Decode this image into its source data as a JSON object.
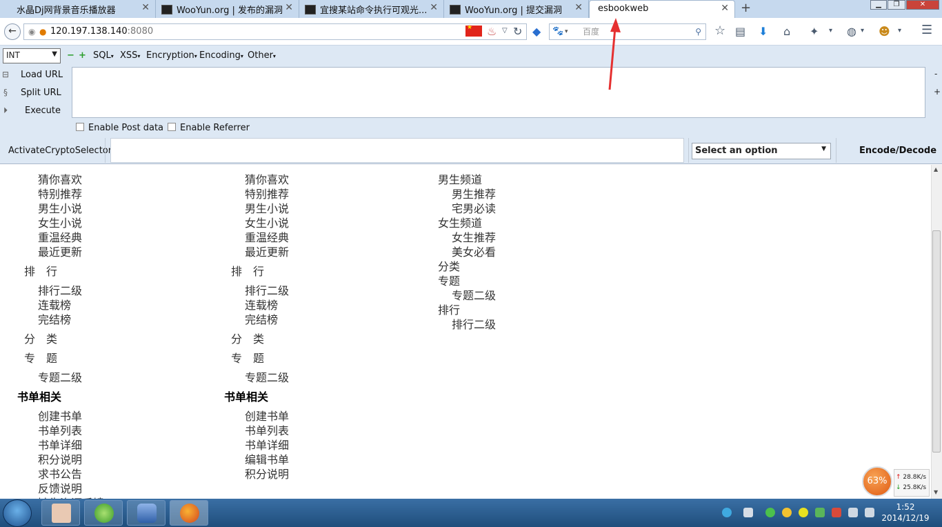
{
  "tabs": [
    {
      "title": "水晶Dj网背景音乐播放器",
      "active": false
    },
    {
      "title": "WooYun.org | 发布的漏洞",
      "active": false
    },
    {
      "title": "宜搜某站命令执行可观光...",
      "active": false
    },
    {
      "title": "WooYun.org | 提交漏洞",
      "active": false
    },
    {
      "title": "esbookweb",
      "active": true
    }
  ],
  "nav": {
    "url_host": "120.197.138.140",
    "url_port": ":8080",
    "search_placeholder": "百度"
  },
  "hackbar": {
    "type_select": "INT",
    "menus": [
      "SQL",
      "XSS",
      "Encryption",
      "Encoding",
      "Other"
    ],
    "load_url": "Load URL",
    "split_url": "Split URL",
    "execute": "Execute",
    "enable_post": "Enable Post data",
    "enable_referrer": "Enable Referrer",
    "crypto_label": "ActivateCryptoSelector",
    "select_option": "Select an option",
    "encode_decode": "Encode/Decode"
  },
  "content": {
    "col1": [
      "猜你喜欢",
      "特别推荐",
      "男生小说",
      "女生小说",
      "重温经典",
      "最近更新",
      "排　行",
      "排行二级",
      "连载榜",
      "完结榜",
      "分　类",
      "专　题",
      "专题二级",
      "书单相关",
      "创建书单",
      "书单列表",
      "书单详细",
      "积分说明",
      "求书公告",
      "反馈说明",
      "缺失资源反馈"
    ],
    "col2": [
      "猜你喜欢",
      "特别推荐",
      "男生小说",
      "女生小说",
      "重温经典",
      "最近更新",
      "排　行",
      "排行二级",
      "连载榜",
      "完结榜",
      "分　类",
      "专　题",
      "专题二级",
      "书单相关",
      "创建书单",
      "书单列表",
      "书单详细",
      "编辑书单",
      "积分说明"
    ],
    "col3": [
      "男生频道",
      "男生推荐",
      "宅男必读",
      "女生频道",
      "女生推荐",
      "美女必看",
      "分类",
      "专题",
      "专题二级",
      "排行",
      "排行二级"
    ]
  },
  "widget": {
    "percent": "63%",
    "up_rate": "28.8K/s",
    "down_rate": "25.8K/s"
  },
  "clock": {
    "time": "1:52",
    "date": "2014/12/19"
  }
}
